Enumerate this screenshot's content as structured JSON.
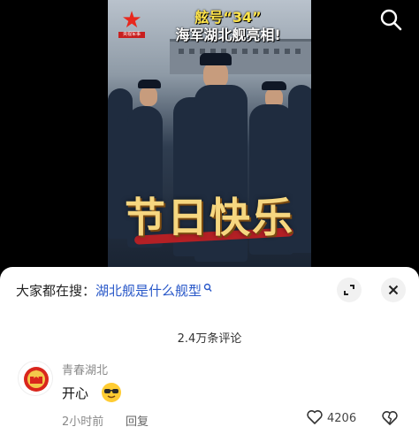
{
  "video": {
    "logo_label": "央视军事",
    "title_line1": "舷号“34”",
    "title_line2": "海军湖北舰亮相!",
    "greeting": "节日快乐"
  },
  "search_bar": {
    "prefix": "大家都在搜：",
    "query": "湖北舰是什么舰型"
  },
  "comments_panel": {
    "count_label": "2.4万条评论",
    "comments": [
      {
        "username": "青春湖北",
        "text": "开心",
        "emoji": "cool-sunglasses-emoji",
        "time": "2小时前",
        "reply_label": "回复",
        "likes": "4206"
      }
    ]
  },
  "colors": {
    "link": "#2a59c9",
    "muted": "#8a8a8a",
    "logo_red": "#e8281e",
    "greeting_gold": "#f6d780"
  },
  "icons": [
    "search-icon",
    "expand-icon",
    "close-icon",
    "heart-icon",
    "dislike-heart-icon",
    "small-search-icon",
    "avatar-badge-icon"
  ]
}
